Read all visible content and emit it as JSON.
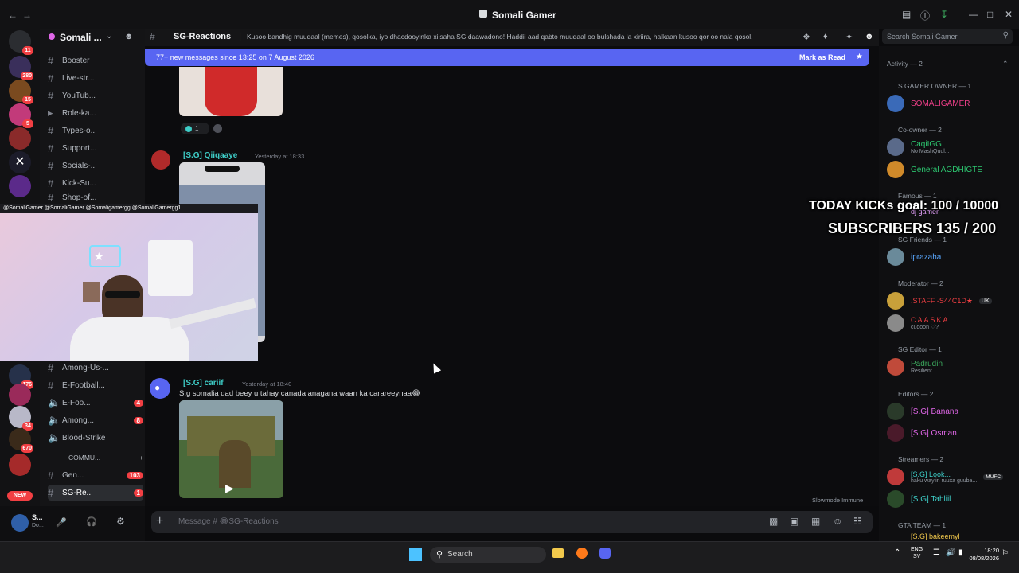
{
  "window": {
    "title": "Somali Gamer"
  },
  "server": {
    "name": "Somali ...",
    "channels_top": [
      {
        "label": "Booster"
      },
      {
        "label": "Live-str..."
      },
      {
        "label": "YouTub..."
      },
      {
        "label": "Role-ka..."
      },
      {
        "label": "Types-o..."
      },
      {
        "label": "Support..."
      },
      {
        "label": "Socials-..."
      },
      {
        "label": "Kick-Su..."
      },
      {
        "label": "Shop-of..."
      }
    ],
    "channels_bottom": [
      {
        "label": "Among-Us-...",
        "count": ""
      },
      {
        "label": "E-Football...",
        "count": ""
      },
      {
        "label": "E-Foo...",
        "count": "4"
      },
      {
        "label": "Among...",
        "count": "8"
      },
      {
        "label": "Blood-Strike",
        "count": ""
      }
    ],
    "category": "COMMU...",
    "channels_comm": [
      {
        "label": "Gen...",
        "count": "103"
      },
      {
        "label": "SG-Re...",
        "count": "1"
      }
    ],
    "guild_badges": [
      "11",
      "280",
      "15",
      "5",
      "176",
      "34",
      "670"
    ],
    "new_badge": "NEW"
  },
  "user_panel": {
    "name": "S...",
    "status": "Do..."
  },
  "header": {
    "channel": "SG-Reactions",
    "topic": "Kusoo bandhig muuqaal (memes), qosolka, iyo dhacdooyinka xiisaha SG daawadono! Haddii aad qabto muuqaal oo bulshada la xiriira, halkaan kusoo qor oo nala qosol."
  },
  "search": {
    "placeholder": "Search Somali Gamer"
  },
  "banner": {
    "text": "77+ new messages since 13:25 on 7 August 2026",
    "action": "Mark as Read"
  },
  "messages": [
    {
      "author": "[S.G] Qiiqaaye",
      "time": "Yesterday at 18:33",
      "text": ""
    },
    {
      "author": "[S.G] cariif",
      "time": "Yesterday at 18:40",
      "text": "S.g somalia dad beey u tahay canada anagana waan ka carareeynaa😂"
    }
  ],
  "reaction": {
    "count": "1"
  },
  "composer": {
    "placeholder": "Message # 😂SG-Reactions",
    "slowmode": "Slowmode Immune"
  },
  "members": {
    "activity_label": "Activity — 2",
    "groups": [
      {
        "role": "S.GAMER OWNER — 1",
        "members": [
          {
            "name": "SOMALIGAMER",
            "color": "#f23f8a",
            "sub": ""
          }
        ]
      },
      {
        "role": "Co-owner — 2",
        "members": [
          {
            "name": "CaqiIGG",
            "color": "#2dc770",
            "sub": "No MashQuul..."
          },
          {
            "name": "General AGDHIGTE",
            "color": "#2dc770",
            "sub": ""
          }
        ]
      },
      {
        "role": "Famous — 1",
        "members": [
          {
            "name": "dj gamer",
            "color": "#e8a3ff",
            "sub": ""
          }
        ]
      },
      {
        "role": "SG Friends — 1",
        "members": [
          {
            "name": "iprazaha",
            "color": "#5aa8ff",
            "sub": ""
          }
        ]
      },
      {
        "role": "Moderator — 2",
        "members": [
          {
            "name": ".STAFF -S44C1D★",
            "color": "#f23f43",
            "sub": ""
          },
          {
            "name": "CAASKA",
            "color": "#f23f43",
            "sub": "cudoon ♡?"
          }
        ]
      },
      {
        "role": "SG Editor — 1",
        "members": [
          {
            "name": "Padrudin",
            "color": "#3ba55c",
            "sub": "Resilient"
          }
        ]
      },
      {
        "role": "Editors — 2",
        "members": [
          {
            "name": "[S.G] Banana",
            "color": "#e067e8",
            "sub": ""
          },
          {
            "name": "[S.G] Osman",
            "color": "#e067e8",
            "sub": ""
          }
        ]
      },
      {
        "role": "Streamers — 2",
        "members": [
          {
            "name": "[S.G] Look...",
            "color": "#3ecdc7",
            "sub": "haku waylin ruuxa guuba..."
          },
          {
            "name": "[S.G] Tahliil",
            "color": "#3ecdc7",
            "sub": ""
          }
        ]
      },
      {
        "role": "GTA TEAM — 1",
        "members": [
          {
            "name": "[S.G] bakeemyl",
            "color": "#f2c94c",
            "sub": ""
          }
        ]
      }
    ],
    "tags": {
      "uk": "UK",
      "mufc": "MUFC"
    }
  },
  "overlay": {
    "kicks": "TODAY KICKs goal: 100 / 10000",
    "subs": "SUBSCRIBERS 135 / 200",
    "socials": "@SomaliGamer  @SomaliGamer  @Somaligamergg  @SomaliGamergg1"
  },
  "taskbar": {
    "search_label": "Search",
    "lang": "ENG",
    "region": "SV",
    "time": "18:20",
    "date": "08/08/2026"
  },
  "colors": {
    "accent": "#5865f2",
    "teal_name": "#3ecdc7",
    "badge": "#f23f43"
  }
}
